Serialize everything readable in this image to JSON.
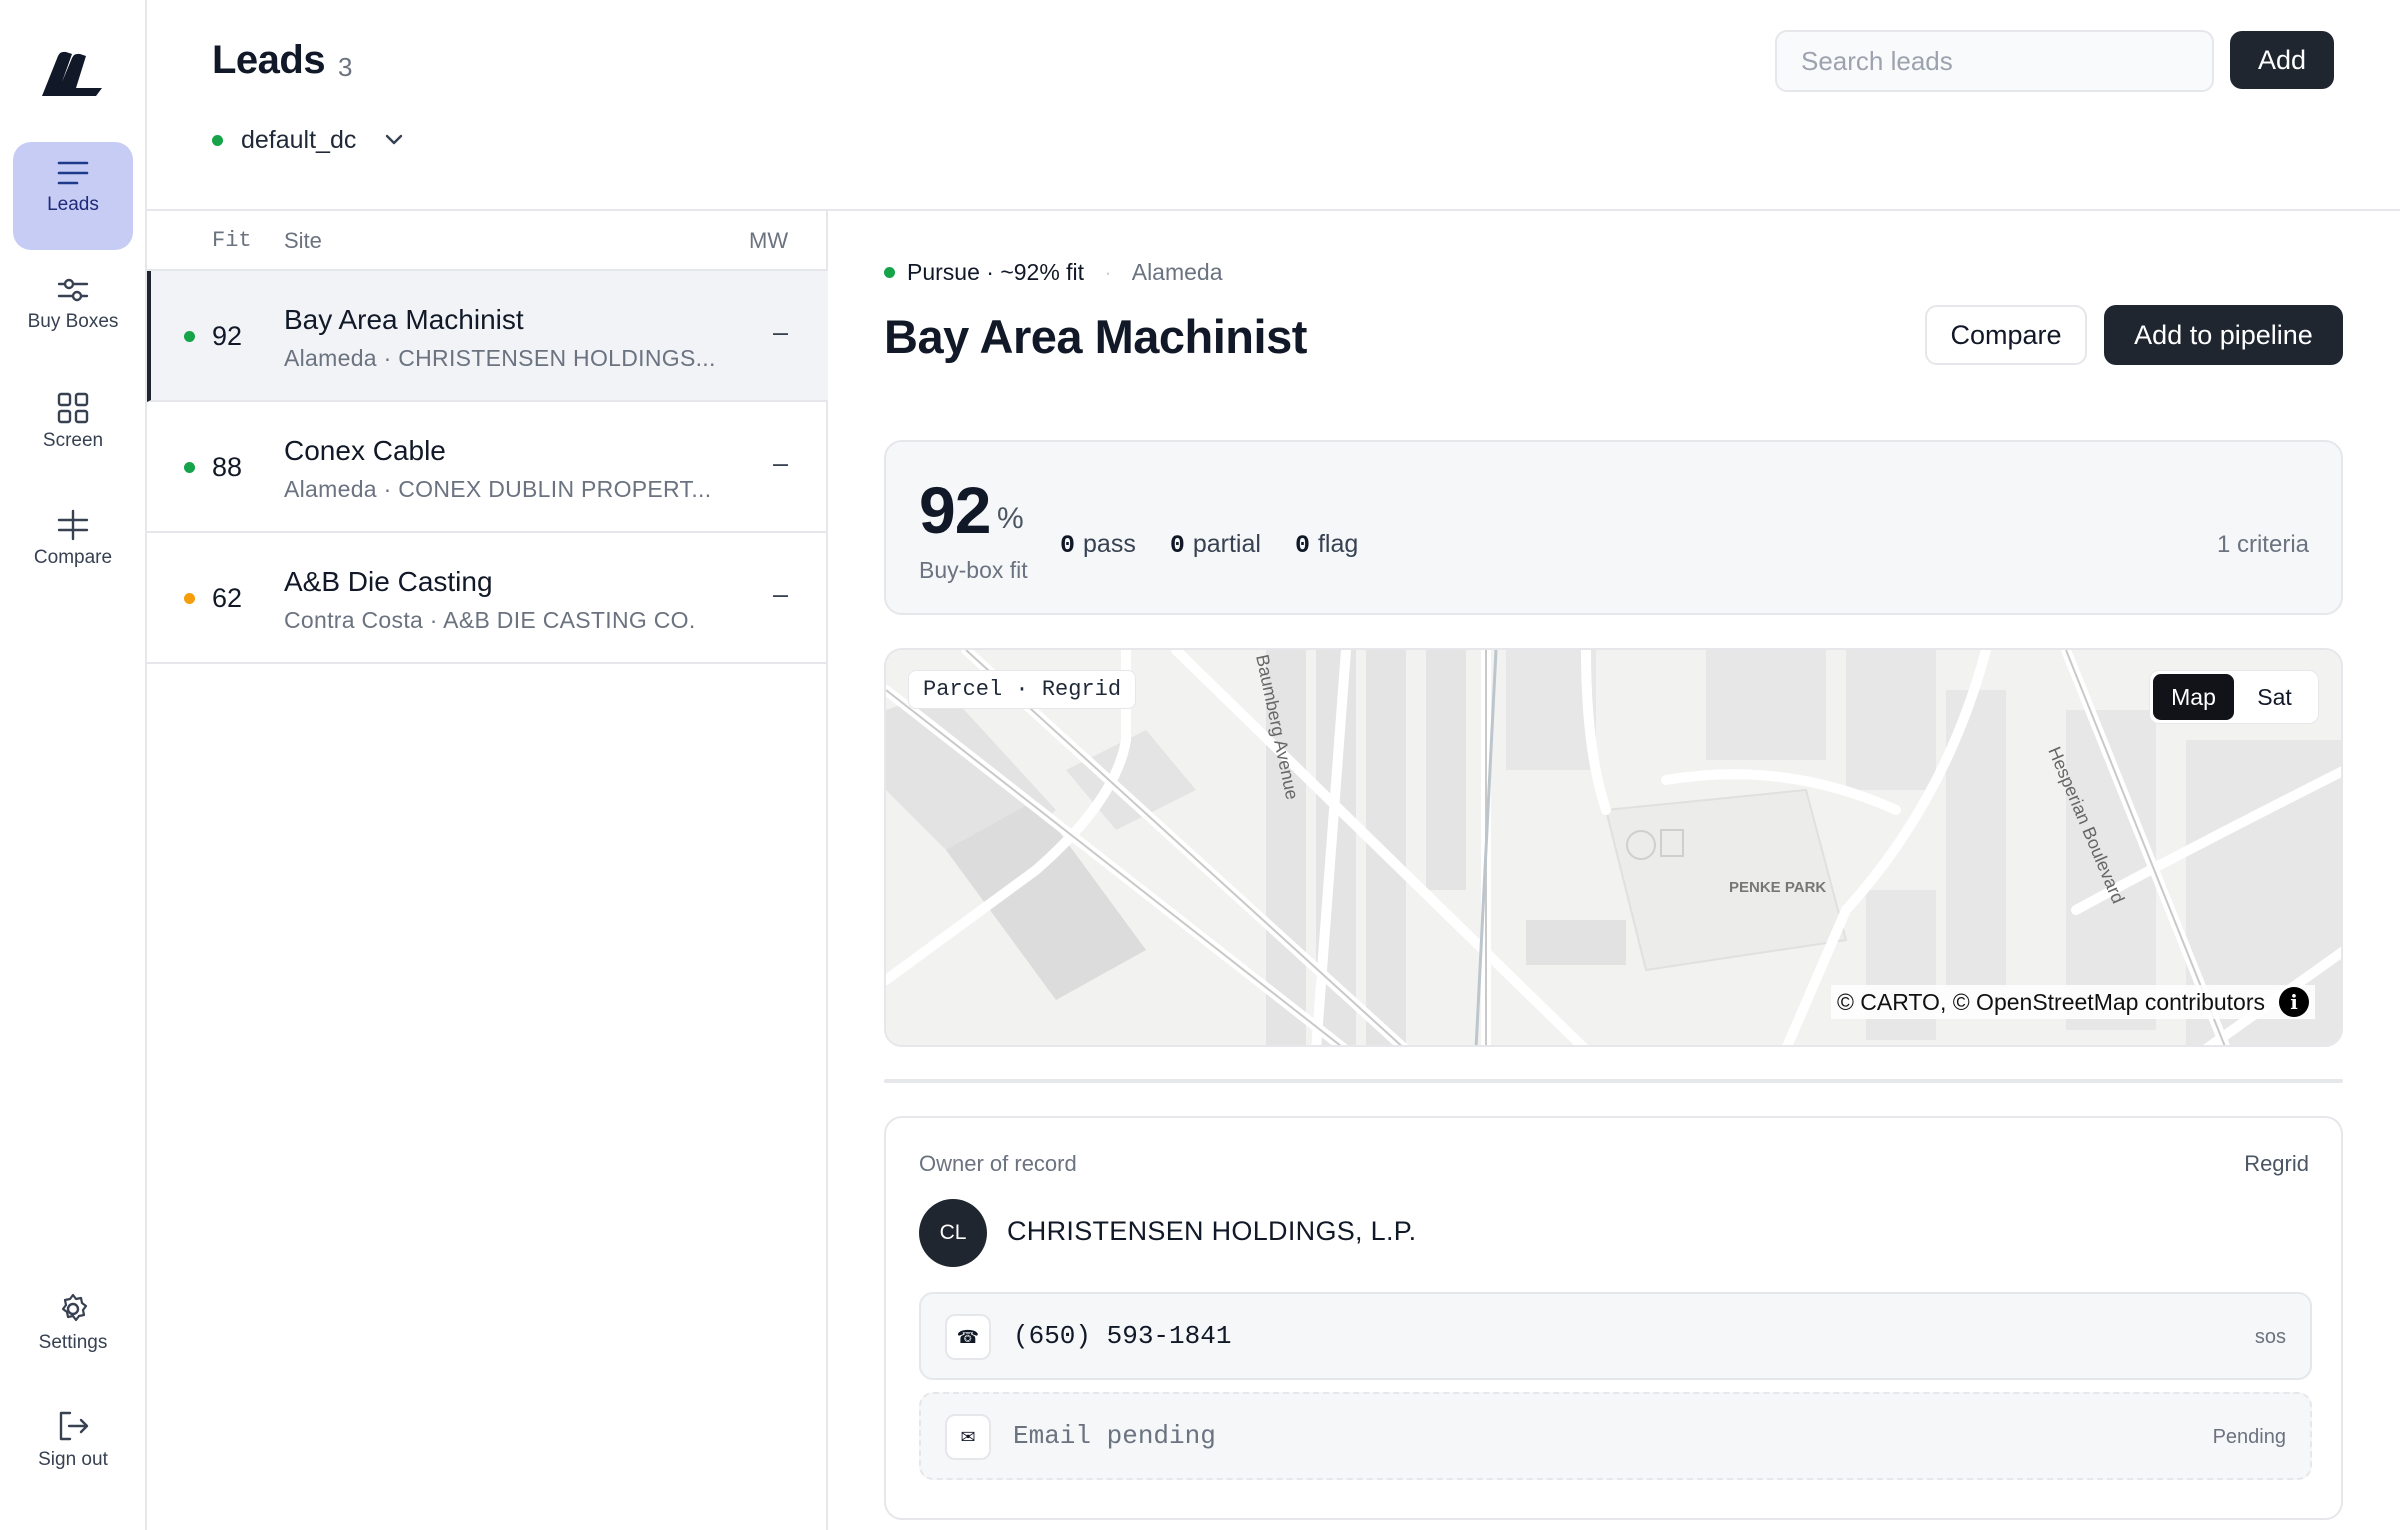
{
  "sidebar": {
    "items": [
      {
        "label": "Leads",
        "icon": "menu-lines-icon",
        "active": true
      },
      {
        "label": "Buy Boxes",
        "icon": "sliders-icon"
      },
      {
        "label": "Screen",
        "icon": "grid-icon"
      },
      {
        "label": "Compare",
        "icon": "compare-icon"
      }
    ],
    "bottom": [
      {
        "label": "Settings",
        "icon": "gear-icon"
      },
      {
        "label": "Sign out",
        "icon": "sign-out-icon"
      }
    ]
  },
  "header": {
    "title": "Leads",
    "count": "3",
    "datacenter": "default_dc",
    "search_placeholder": "Search leads",
    "add_label": "Add"
  },
  "list": {
    "columns": {
      "fit": "Fit",
      "site": "Site",
      "mw": "MW"
    },
    "rows": [
      {
        "fit": "92",
        "name": "Bay Area Machinist",
        "sub": "Alameda · CHRISTENSEN HOLDINGS...",
        "mw": "–",
        "status_color": "#16a34a"
      },
      {
        "fit": "88",
        "name": "Conex Cable",
        "sub": "Alameda · CONEX DUBLIN PROPERT...",
        "mw": "–",
        "status_color": "#16a34a"
      },
      {
        "fit": "62",
        "name": "A&B Die Casting",
        "sub": "Contra Costa · A&B DIE CASTING CO.",
        "mw": "–",
        "status_color": "#f59e0b"
      }
    ]
  },
  "detail": {
    "status": "Pursue · ~92% fit",
    "separator": "·",
    "location": "Alameda",
    "title": "Bay Area Machinist",
    "compare_label": "Compare",
    "pipeline_label": "Add to pipeline",
    "fit": {
      "value": "92",
      "unit": "%",
      "label": "Buy-box fit",
      "pass": "0",
      "pass_label": "pass",
      "partial": "0",
      "partial_label": "partial",
      "flag": "0",
      "flag_label": "flag",
      "criteria": "1 criteria"
    },
    "map": {
      "tag": "Parcel · Regrid",
      "toggle_map": "Map",
      "toggle_sat": "Sat",
      "attribution": "© CARTO, © OpenStreetMap contributors",
      "info": "i",
      "labels": {
        "street1": "Baumberg Avenue",
        "street2": "Hesperian Boulevard",
        "park": "PENKE PARK"
      }
    },
    "owner": {
      "label": "Owner of record",
      "source": "Regrid",
      "initials": "CL",
      "name": "CHRISTENSEN HOLDINGS, L.P.",
      "phone": "(650) 593-1841",
      "phone_source": "sos",
      "email": "Email pending",
      "email_source": "Pending"
    }
  },
  "colors": {
    "accent": "#1f2630",
    "active_nav": "#c7ccf4",
    "green": "#16a34a",
    "amber": "#f59e0b"
  }
}
